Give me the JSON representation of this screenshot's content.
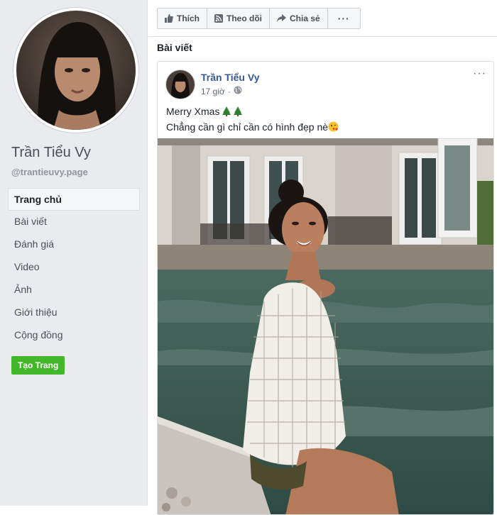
{
  "sidebar": {
    "page_name": "Trần Tiểu Vy",
    "page_handle": "@trantieuvy.page",
    "nav_items": [
      {
        "label": "Trang chủ",
        "active": true
      },
      {
        "label": "Bài viết"
      },
      {
        "label": "Đánh giá"
      },
      {
        "label": "Video"
      },
      {
        "label": "Ảnh"
      },
      {
        "label": "Giới thiệu"
      },
      {
        "label": "Cộng đồng"
      }
    ],
    "create_button": "Tạo Trang"
  },
  "action_bar": {
    "like": "Thích",
    "follow": "Theo dõi",
    "share": "Chia sẻ",
    "more": "···"
  },
  "section_title": "Bài viết",
  "post": {
    "author": "Trần Tiểu Vy",
    "time": "17 giờ",
    "separator": "·",
    "privacy_icon": "globe-icon",
    "menu": "···",
    "line1": "Merry Xmas",
    "line2": "Chẳng cần gì chỉ cần có hình đẹp nè"
  },
  "colors": {
    "sidebar_bg": "#e9ebee",
    "link_blue": "#385898",
    "create_green": "#42b72a"
  }
}
